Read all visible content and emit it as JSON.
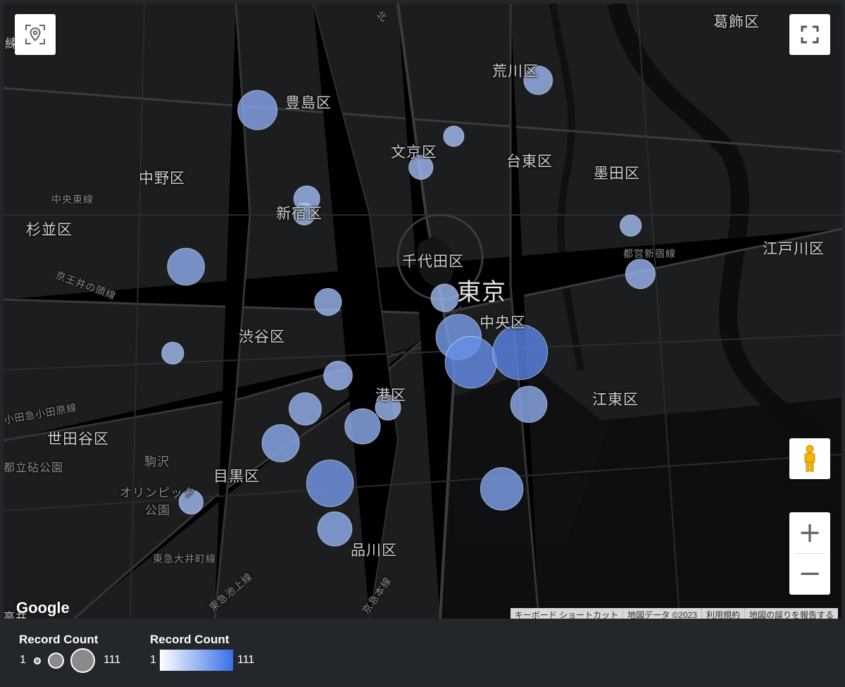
{
  "map": {
    "district_labels": {
      "katsushika": "葛飾区",
      "arakawa": "荒川区",
      "toshima": "豊島区",
      "bunkyo": "文京区",
      "taito": "台東区",
      "sumida": "墨田区",
      "nakano": "中野区",
      "suginami": "杉並区",
      "shinjuku": "新宿区",
      "edogawa": "江戸川区",
      "chiyoda": "千代田区",
      "tokyo": "東京",
      "chuo": "中央区",
      "shibuya": "渋谷区",
      "minato": "港区",
      "koto": "江東区",
      "setagaya": "世田谷区",
      "meguro": "目黒区",
      "shinagawa": "品川区",
      "komazawa": "駒沢",
      "olympic_park": "オリンピック\n公園",
      "toritsu_kasai": "都立砧公園",
      "keio_line": "京王井の頭線",
      "chuo_line": "中央東線",
      "odakyu": "小田急小田原線",
      "tokyu_oimachi": "東急大井町線",
      "tokyu_ikegami": "東急池上線",
      "keikyu": "京急本線",
      "toei": "都営新宿線",
      "takaoka": "高井",
      "nerima": "練",
      "kita": "北"
    },
    "records": [
      {
        "lat": 35.7421,
        "lng": 139.7138,
        "count": 48
      },
      {
        "lat": 35.6937,
        "lng": 139.6916,
        "count": 41
      },
      {
        "lat": 35.6601,
        "lng": 139.7388,
        "count": 20
      },
      {
        "lat": 35.6392,
        "lng": 139.721,
        "count": 42
      },
      {
        "lat": 35.6268,
        "lng": 139.7363,
        "count": 75
      },
      {
        "lat": 35.6127,
        "lng": 139.7378,
        "count": 33
      },
      {
        "lat": 35.6444,
        "lng": 139.7464,
        "count": 36
      },
      {
        "lat": 35.6502,
        "lng": 139.7543,
        "count": 14
      },
      {
        "lat": 35.672,
        "lng": 139.7762,
        "count": 69
      },
      {
        "lat": 35.6642,
        "lng": 139.78,
        "count": 95
      },
      {
        "lat": 35.6673,
        "lng": 139.7953,
        "count": 111
      },
      {
        "lat": 35.6512,
        "lng": 139.798,
        "count": 39
      },
      {
        "lat": 35.6251,
        "lng": 139.7896,
        "count": 59
      },
      {
        "lat": 35.7513,
        "lng": 139.8009,
        "count": 20
      },
      {
        "lat": 35.6915,
        "lng": 139.8326,
        "count": 22
      },
      {
        "lat": 35.6841,
        "lng": 139.7719,
        "count": 18
      },
      {
        "lat": 35.6828,
        "lng": 139.7357,
        "count": 17
      },
      {
        "lat": 35.621,
        "lng": 139.6932,
        "count": 12
      },
      {
        "lat": 35.667,
        "lng": 139.6875,
        "count": 9
      },
      {
        "lat": 35.7147,
        "lng": 139.7291,
        "count": 15
      },
      {
        "lat": 35.6498,
        "lng": 139.7286,
        "count": 28
      },
      {
        "lat": 35.7244,
        "lng": 139.7645,
        "count": 12
      },
      {
        "lat": 35.7064,
        "lng": 139.8296,
        "count": 8
      },
      {
        "lat": 35.734,
        "lng": 139.7747,
        "count": 7
      },
      {
        "lat": 35.71,
        "lng": 139.7283,
        "count": 9
      }
    ],
    "controls": {
      "zoom_in": "+",
      "zoom_out": "−",
      "logo": "Google",
      "attribution": [
        "キーボード ショートカット",
        "地図データ ©2023",
        "利用規約",
        "地図の誤りを報告する"
      ]
    }
  },
  "legend": {
    "size": {
      "title": "Record Count",
      "min": "1",
      "max": "111"
    },
    "color": {
      "title": "Record Count",
      "min": "1",
      "max": "111",
      "from": "#ffffff",
      "to": "#3a6fe8"
    }
  },
  "colors": {
    "bubble_fill": "#a9c2f4",
    "bubble_fill_high": "#5b86e6",
    "bubble_stroke": "#e4ecff",
    "map_bg": "#1b1c1e",
    "road": "#3a3b3d"
  }
}
